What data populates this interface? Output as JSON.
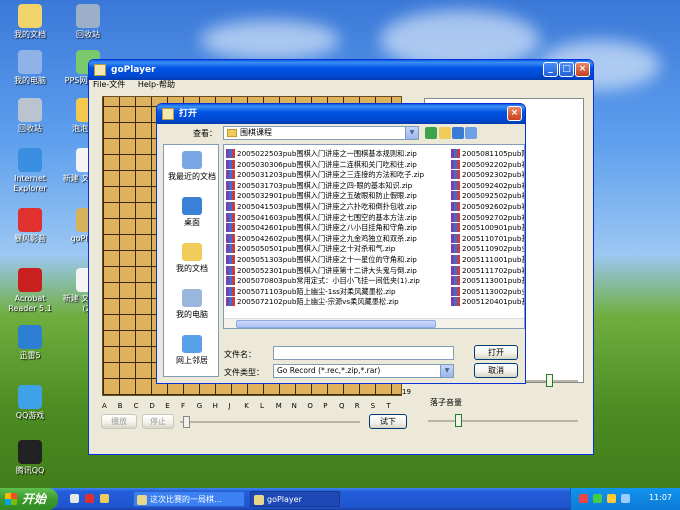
{
  "desktop_icons": [
    {
      "label": "我的文档",
      "color": "#f0d36a"
    },
    {
      "label": "回收站",
      "color": "#9bb0c8"
    },
    {
      "label": "我的电脑",
      "color": "#8fb3e6"
    },
    {
      "label": "PPS网络电视",
      "color": "#7bc96d"
    },
    {
      "label": "回收站",
      "color": "#b9c4d0"
    },
    {
      "label": "泡泡游戏",
      "color": "#f2c94c"
    },
    {
      "label": "Internet Explorer",
      "color": "#3b8fe0"
    },
    {
      "label": "新建 文本文档",
      "color": "#f4f4f4"
    },
    {
      "label": "暴风影音",
      "color": "#e03030"
    },
    {
      "label": "goPlayer",
      "color": "#d6b35a"
    },
    {
      "label": "Acrobat Reader 5.1",
      "color": "#c82020"
    },
    {
      "label": "新建 文本文档 (2)",
      "color": "#f4f4f4"
    },
    {
      "label": "迅雷5",
      "color": "#2d7fd3"
    },
    {
      "label": "QQ游戏",
      "color": "#3fa1e8"
    },
    {
      "label": "腾讯QQ",
      "color": "#222"
    }
  ],
  "taskbar": {
    "start": "开始",
    "tasks": [
      "这次比赛的一局棋…",
      "goPlayer"
    ],
    "clock": "11:07"
  },
  "goplayer": {
    "title": "goPlayer",
    "menu": [
      "File-文件",
      "Help-帮助"
    ],
    "col_labels": [
      "A",
      "B",
      "C",
      "D",
      "E",
      "F",
      "G",
      "H",
      "J",
      "K",
      "L",
      "M",
      "N",
      "O",
      "P",
      "Q",
      "R",
      "S",
      "T"
    ],
    "row_label": "19",
    "play_btn": "播放",
    "stop_btn": "停止",
    "next_btn": "试下",
    "volume_label": "落子音量"
  },
  "open_dialog": {
    "title": "打开",
    "look_in_label": "查看：",
    "look_in_value": "围棋课程",
    "places": [
      "我最近的文档",
      "桌面",
      "我的文档",
      "我的电脑",
      "网上邻居"
    ],
    "files_left": [
      "2005022503pub围棋入门讲座之一围棋基本规则和.zip",
      "2005030306pub围棋入门讲座二连棋和关门吃和往.zip",
      "2005031203pub围棋入门讲座之三连接的方法和吃子.zip",
      "2005031703pub围棋入门讲座之四-眼的基本知识.zip",
      "2005032901pub围棋入门讲座之五破眼和防止假眼.zip",
      "2005041503pub围棋入门讲座之六扑吃和倒扑包收.zip",
      "2005041603pub围棋入门讲座之七围空的基本方法.zip",
      "2005042601pub围棋入门讲座之八小目挂角和守角.zip",
      "2005042602pub围棋入门讲座之九金鸡独立和双杀.zip",
      "2005050501pub围棋入门讲座之十对杀和气.zip",
      "2005051303pub围棋入门讲座之十一星位的守角和.zip",
      "2005052301pub围棋入门讲座第十二讲大头鬼与倒.zip",
      "2005070803pub常用定式：小目小飞挂一间低夹(1).zip",
      "2005071103pub陌上幽尘-1ss对柔风藏墨松.zip",
      "2005072102pub陌上幽尘-宗源vs柔风藏墨松.zip"
    ],
    "files_right": [
      "2005081105pub陌上",
      "2005092202pub初级",
      "2005092302pub初级",
      "2005092402pub初级",
      "2005092502pub初级",
      "2005092602pub初级",
      "2005092702pub初级",
      "2005100901pub基础",
      "2005110701pub基础",
      "2005110902pub业5",
      "2005111001pub基础",
      "2005111702pub初级",
      "2005113001pub基础",
      "2005113002pub业5",
      "2005120401pub基础"
    ],
    "filename_label": "文件名：",
    "filename_value": "",
    "filetype_label": "文件类型：",
    "filetype_value": "Go Record (*.rec,*.zip,*.rar)",
    "open_btn": "打开",
    "cancel_btn": "取消"
  }
}
